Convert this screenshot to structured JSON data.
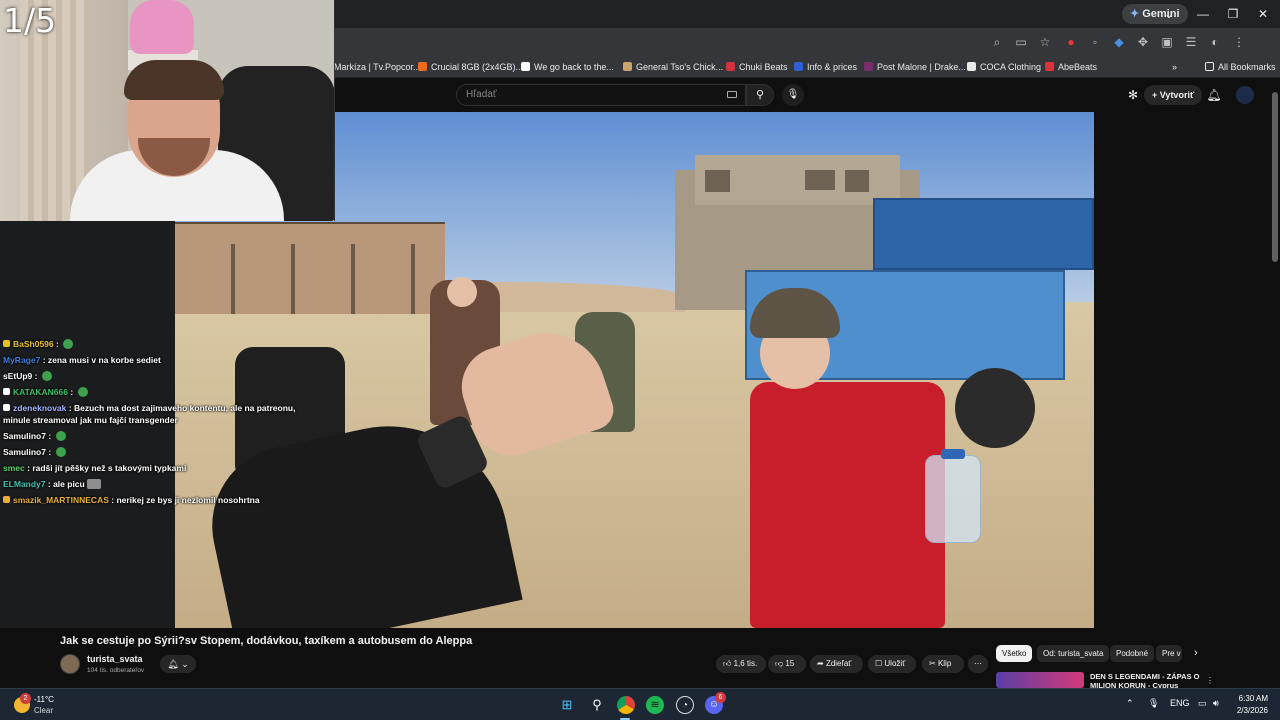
{
  "stream": {
    "counter": "1/5"
  },
  "browser": {
    "gemini_label": "Gemini",
    "window_controls": [
      "⌄",
      "—",
      "❐",
      "✕"
    ],
    "bookmarks": [
      {
        "label": "Markíza | Tv.Popcor...",
        "color": "#4a90d9"
      },
      {
        "label": "Crucial 8GB (2x4GB)...",
        "color": "#f26b1d"
      },
      {
        "label": "We go back to the...",
        "color": "#ffffff"
      },
      {
        "label": "General Tso's Chick...",
        "color": "#c9a36b"
      },
      {
        "label": "Chuki Beats",
        "color": "#d1313f"
      },
      {
        "label": "Info & prices",
        "color": "#2f5fd0"
      },
      {
        "label": "Post Malone | Drake...",
        "color": "#7a2d6c"
      },
      {
        "label": "COCA Clothing",
        "color": "#e8e8e8"
      },
      {
        "label": "AbeBeats",
        "color": "#e0303a"
      }
    ],
    "all_bookmarks": "All Bookmarks"
  },
  "youtube": {
    "search_placeholder": "Hľadať",
    "create_label": "Vytvoriť",
    "video_title": "Jak se cestuje po Sýrii?sv Stopem, dodávkou, taxíkem a autobusem do Aleppa",
    "channel_name": "turista_svata",
    "subscribers": "104 tis. odberateľov",
    "likes": "1,6 tis.",
    "dislikes": "15",
    "share_label": "Zdieľať",
    "save_label": "Uložiť",
    "clip_label": "Klip",
    "chips": [
      "Všetko",
      "Od: turista_svata",
      "Podobné",
      "Pre v"
    ],
    "recommended_title": "DEN S LEGENDAMI - ZÁPAS O MILION KORUN - Cyprus"
  },
  "chat": [
    {
      "user": "BaSh0596",
      "color": "#e8c12a",
      "text": "",
      "emote": "green"
    },
    {
      "user": "MyRage7",
      "color": "#3d7fe0",
      "text": "zena musi v na korbe sediet",
      "emote": ""
    },
    {
      "user": "sEtUp9",
      "color": "#ffffff",
      "text": "",
      "emote": "green"
    },
    {
      "user": "KATAKAN666",
      "color": "#3fbf6a",
      "text": "",
      "emote": "green"
    },
    {
      "user": "zdeneknovak",
      "color": "#a8b7ff",
      "text": "Bezuch ma dost zajimaveho kontentu, ale na patreonu, minule streamoval jak mu fajčí transgender",
      "emote": ""
    },
    {
      "user": "Samulino7",
      "color": "#f1f1f1",
      "text": "",
      "emote": "green"
    },
    {
      "user": "Samulino7",
      "color": "#f1f1f1",
      "text": "",
      "emote": "green"
    },
    {
      "user": "smec",
      "color": "#5bd46a",
      "text": "radši jít pěšky než s takovými typkami",
      "emote": ""
    },
    {
      "user": "ELMandy7",
      "color": "#40c2b0",
      "text": "ale picu",
      "emote": "img"
    },
    {
      "user": "smazik_MARTINNECAS",
      "color": "#e9b13a",
      "text": "nerikej ze bys ji nezlomil nosohrtna",
      "emote": ""
    }
  ],
  "taskbar": {
    "weather_badge": "2",
    "temperature": "-11°C",
    "condition": "Clear",
    "discord_badge": "6",
    "language": "ENG",
    "time": "6:30 AM",
    "date": "2/3/2026"
  }
}
